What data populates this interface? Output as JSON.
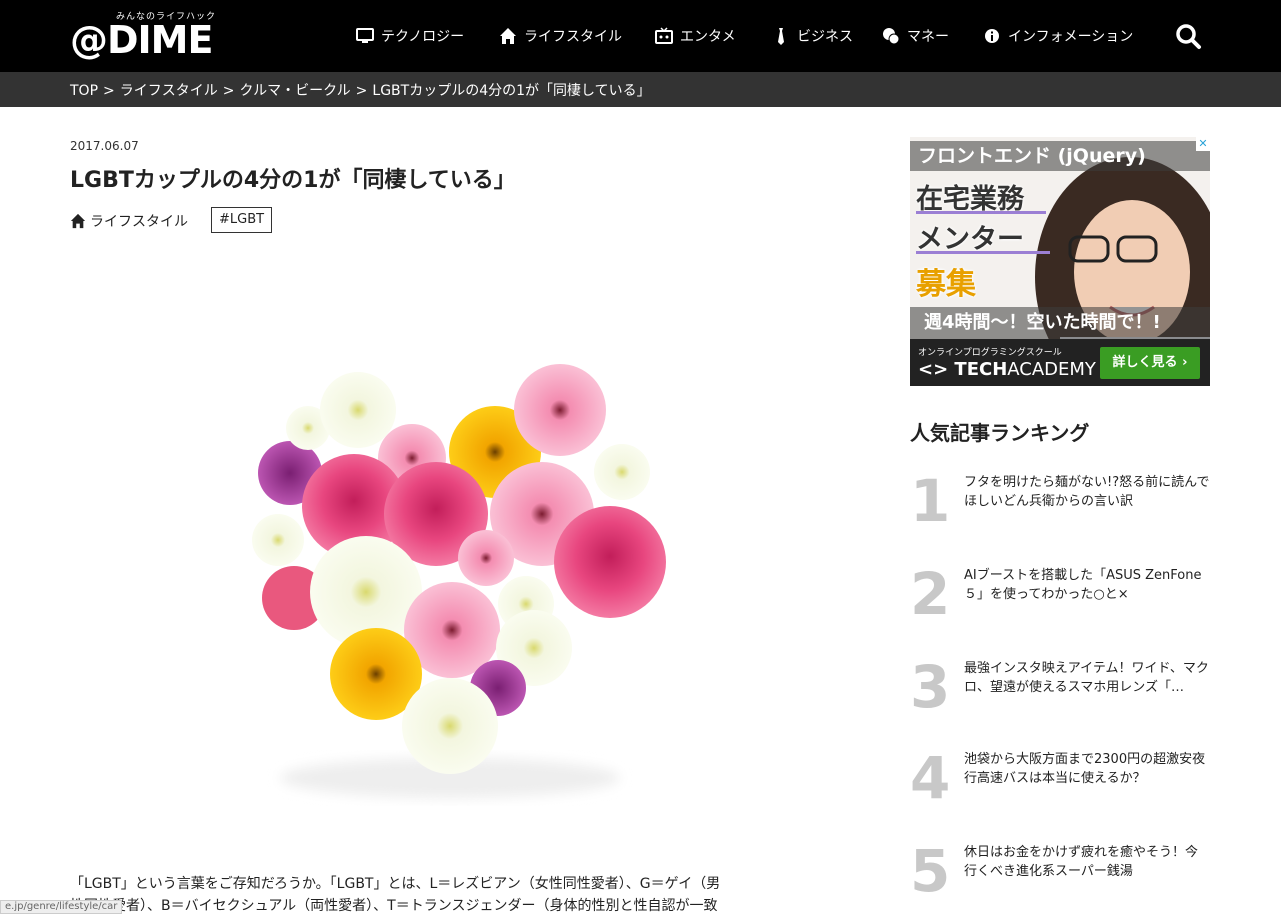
{
  "header": {
    "logo_tagline": "みんなのライフハック",
    "logo_text": "@DIME",
    "nav": [
      {
        "label": "テクノロジー",
        "icon": "monitor-icon"
      },
      {
        "label": "ライフスタイル",
        "icon": "house-icon"
      },
      {
        "label": "エンタメ",
        "icon": "tv-icon"
      },
      {
        "label": "ビジネス",
        "icon": "necktie-icon"
      },
      {
        "label": "マネー",
        "icon": "coins-icon"
      },
      {
        "label": "インフォメーション",
        "icon": "info-icon"
      }
    ]
  },
  "breadcrumb": [
    "TOP",
    "ライフスタイル",
    "クルマ・ビークル",
    "LGBTカップルの4分の1が「同棲している」"
  ],
  "article": {
    "date": "2017.06.07",
    "title": "LGBTカップルの4分の1が「同棲している」",
    "category": "ライフスタイル",
    "tag": "#LGBT",
    "body_line1": "「LGBT」という言葉をご存知だろうか。「LGBT」とは、L＝レズビアン（女性同性愛者）、G＝ゲイ（男",
    "body_line2": "性同性愛者）、B＝バイセクシュアル（両性愛者）、T＝トランスジェンダー（身体的性別と性自認が一致"
  },
  "status_url": "e.jp/genre/lifestyle/car",
  "ad": {
    "line1": "フロントエンド (jQuery)",
    "line2": "在宅業務",
    "line3": "メンター",
    "line4": "募集",
    "line5": "週4時間～！空いた時間で！!",
    "school": "オンラインプログラミングスクール",
    "brand_left": "<> TECH",
    "brand_right": "ACADEMY",
    "cta": "詳しく見る ›",
    "adchoice": "✕"
  },
  "ranking": {
    "heading": "人気記事ランキング",
    "items": [
      {
        "num": "1",
        "title": "フタを明けたら麺がない!?怒る前に読んでほしいどん兵衛からの言い訳"
      },
      {
        "num": "2",
        "title": "AIブーストを搭載した「ASUS ZenFone ５」を使ってわかった○と×"
      },
      {
        "num": "3",
        "title": "最強インスタ映えアイテム！ワイド、マクロ、望遠が使えるスマホ用レンズ「…"
      },
      {
        "num": "4",
        "title": "池袋から大阪方面まで2300円の超激安夜行高速バスは本当に使えるか？"
      },
      {
        "num": "5",
        "title": "休日はお金をかけず疲れを癒やそう！今行くべき進化系スーパー銭湯"
      }
    ]
  }
}
